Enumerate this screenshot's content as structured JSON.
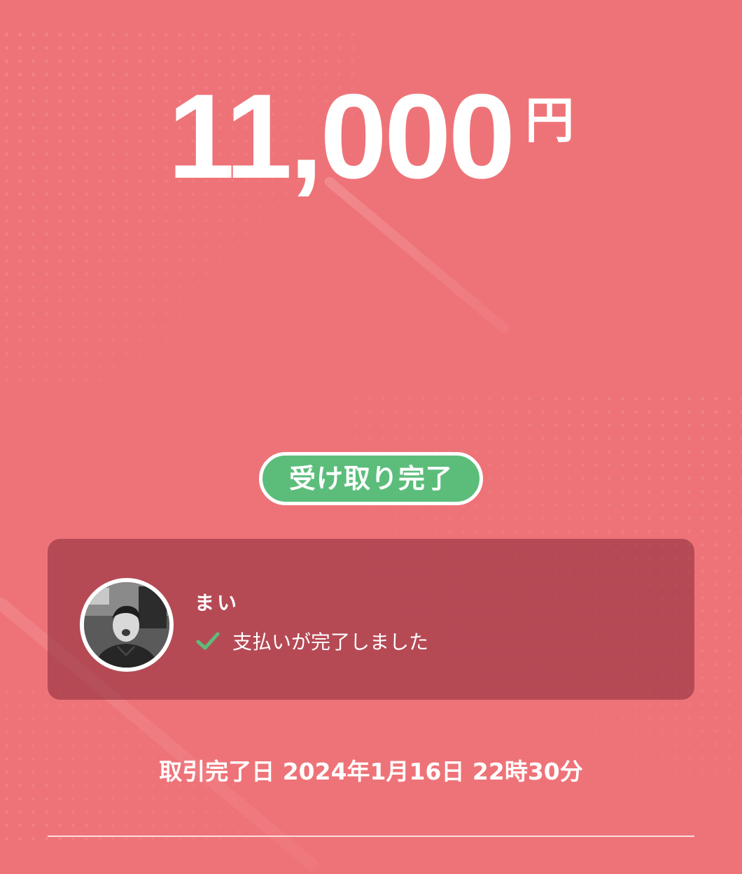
{
  "colors": {
    "background": "#ee7378",
    "badge": "#5cbd7b",
    "card": "#9a3846",
    "check": "#5cbd7b",
    "text": "#ffffff"
  },
  "amount": {
    "value": "11,000",
    "unit": "円"
  },
  "status_badge": {
    "label": "受け取り完了"
  },
  "sender": {
    "name": "まい",
    "avatar": "profile-photo",
    "status_icon": "check-icon",
    "status_text": "支払いが完了しました"
  },
  "completion": {
    "text": "取引完了日 2024年1月16日 22時30分"
  }
}
